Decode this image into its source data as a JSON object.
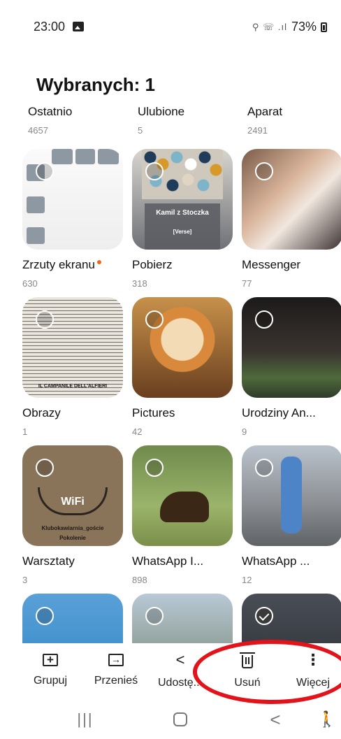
{
  "status_bar": {
    "time": "23:00",
    "network_indicators": "⚲ ☏ .ıl",
    "battery": "73%"
  },
  "header": {
    "title": "Wybranych: 1"
  },
  "albums_partial": [
    {
      "name": "Ostatnio",
      "count": "4657"
    },
    {
      "name": "Ulubione",
      "count": "5"
    },
    {
      "name": "Aparat",
      "count": "2491"
    }
  ],
  "albums": [
    {
      "name": "Zrzuty ekranu",
      "count": "630",
      "has_new_dot": true
    },
    {
      "name": "Pobierz",
      "count": "318",
      "thumb_title": "Kamil z Stoczka",
      "thumb_subtitle": "[Verse]"
    },
    {
      "name": "Messenger",
      "count": "77"
    },
    {
      "name": "Obrazy",
      "count": "1",
      "thumb_caption": "IL CAMPANILE DELL'ALFIERI"
    },
    {
      "name": "Pictures",
      "count": "42"
    },
    {
      "name": "Urodziny An...",
      "count": "9"
    },
    {
      "name": "Warsztaty",
      "count": "3",
      "thumb_title": "WiFi",
      "thumb_caption": "Klubokawiarnia_goście",
      "thumb_subcaption": "Pokolenie"
    },
    {
      "name": "WhatsApp I...",
      "count": "898"
    },
    {
      "name": "WhatsApp ...",
      "count": "12"
    }
  ],
  "row4_selected_index": 2,
  "actions": [
    {
      "label": "Grupuj",
      "icon": "group-icon"
    },
    {
      "label": "Przenieś",
      "icon": "move-icon"
    },
    {
      "label": "Udostę...",
      "icon": "share-icon"
    },
    {
      "label": "Usuń",
      "icon": "trash-icon"
    },
    {
      "label": "Więcej",
      "icon": "more-icon"
    }
  ],
  "nav": {
    "recent_glyph": "|||",
    "back_glyph": "<",
    "accessibility_glyph": "🚶"
  },
  "colors": {
    "annotation_red": "#e3131b",
    "new_dot": "#e96a1f"
  }
}
